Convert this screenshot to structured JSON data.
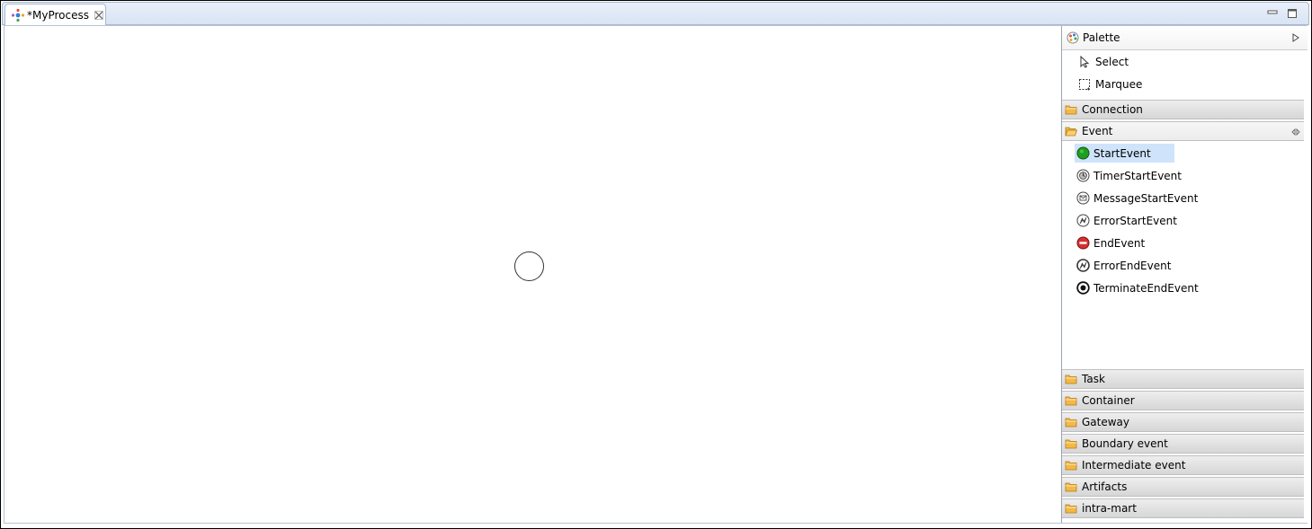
{
  "editor_tab": {
    "title": "*MyProcess"
  },
  "palette": {
    "title": "Palette",
    "tools": [
      {
        "label": "Select"
      },
      {
        "label": "Marquee"
      }
    ],
    "drawers": {
      "connection": "Connection",
      "event": "Event",
      "task": "Task",
      "container": "Container",
      "gateway": "Gateway",
      "boundary_event": "Boundary event",
      "intermediate_event": "Intermediate event",
      "artifacts": "Artifacts",
      "intra_mart": "intra-mart"
    },
    "event_entries": [
      {
        "label": "StartEvent",
        "icon": "start-event-icon",
        "selected": true
      },
      {
        "label": "TimerStartEvent",
        "icon": "timer-start-event-icon"
      },
      {
        "label": "MessageStartEvent",
        "icon": "message-start-event-icon"
      },
      {
        "label": "ErrorStartEvent",
        "icon": "error-start-event-icon"
      },
      {
        "label": "EndEvent",
        "icon": "end-event-icon"
      },
      {
        "label": "ErrorEndEvent",
        "icon": "error-end-event-icon"
      },
      {
        "label": "TerminateEndEvent",
        "icon": "terminate-end-event-icon"
      }
    ]
  },
  "colors": {
    "start_event": "#1e9e1e",
    "end_event": "#d83030",
    "selection": "#cfe3fb",
    "folder": "#f4b844"
  }
}
